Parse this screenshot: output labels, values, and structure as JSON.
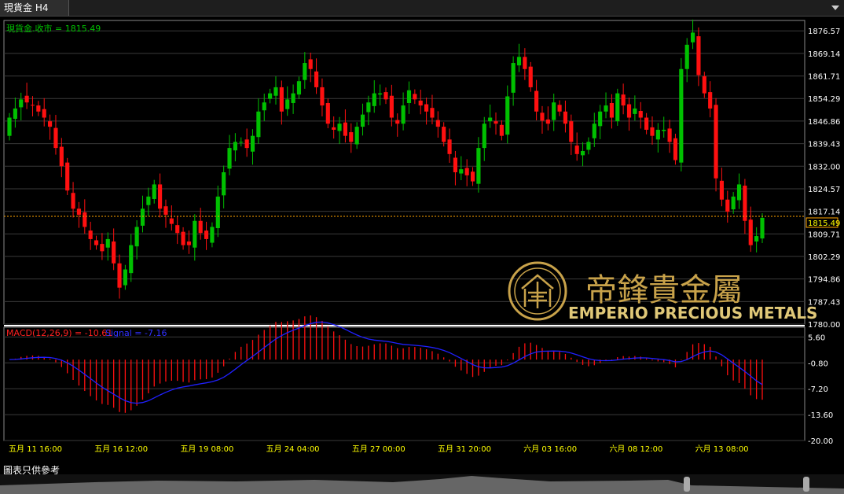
{
  "window": {
    "tab_title": "現貨金 H4"
  },
  "main_panel": {
    "label": "現貨金.收市 = 1815.49",
    "label_color": "#00c000",
    "current_price": "1815.49"
  },
  "macd_panel": {
    "label_name": "MACD(12,26,9) = -10.61",
    "label_signal": "Signal = -7.16",
    "name_color": "#ff2020",
    "signal_color": "#3030ff"
  },
  "watermark": {
    "chinese": "帝鋒貴金屬",
    "english": "EMPERIO PRECIOUS METALS",
    "color": "#c8a24a"
  },
  "footer": {
    "disclaimer": "圖表只供參考"
  },
  "colors": {
    "up": "#00c000",
    "down": "#ff1010",
    "grid": "#3a3a3a",
    "axis_text": "#ffffff",
    "date_text": "#ffff00",
    "price_line": "#ffa500"
  },
  "chart_data": [
    {
      "type": "candlestick",
      "title": "現貨金 H4",
      "ylim": [
        1780.0,
        1880.0
      ],
      "y_ticks": [
        "1876.57",
        "1869.14",
        "1861.71",
        "1854.29",
        "1846.86",
        "1839.43",
        "1832.00",
        "1824.57",
        "1817.14",
        "1809.71",
        "1802.29",
        "1794.86",
        "1787.43",
        "1780.00"
      ],
      "x_tick_labels": [
        "五月 11 16:00",
        "五月 16 12:00",
        "五月 19 08:00",
        "五月 24 04:00",
        "五月 27 00:00",
        "五月 31 20:00",
        "六月 03 16:00",
        "六月 08 12:00",
        "六月 13 08:00"
      ],
      "last_price": 1815.49,
      "close": [
        1848,
        1851,
        1854,
        1853,
        1852,
        1850,
        1848,
        1845,
        1838,
        1832,
        1824,
        1818,
        1816,
        1812,
        1808,
        1806,
        1804,
        1808,
        1800,
        1792,
        1798,
        1806,
        1812,
        1818,
        1822,
        1826,
        1818,
        1816,
        1813,
        1810,
        1806,
        1806,
        1814,
        1810,
        1808,
        1812,
        1822,
        1830,
        1838,
        1840,
        1840,
        1838,
        1842,
        1850,
        1853,
        1856,
        1858,
        1850,
        1854,
        1856,
        1860,
        1866,
        1864,
        1858,
        1852,
        1846,
        1844,
        1846,
        1842,
        1840,
        1845,
        1849,
        1853,
        1856,
        1856,
        1854,
        1848,
        1846,
        1852,
        1857,
        1854,
        1852,
        1850,
        1848,
        1845,
        1840,
        1836,
        1830,
        1831,
        1829,
        1827,
        1838,
        1846,
        1848,
        1846,
        1842,
        1855,
        1866,
        1868,
        1864,
        1858,
        1850,
        1847,
        1846,
        1853,
        1850,
        1846,
        1840,
        1836,
        1837,
        1840,
        1846,
        1850,
        1852,
        1848,
        1856,
        1852,
        1848,
        1851,
        1848,
        1844,
        1842,
        1844,
        1844,
        1840,
        1834,
        1864,
        1872,
        1876,
        1862,
        1856,
        1851,
        1828,
        1821,
        1817,
        1822,
        1826,
        1814,
        1806,
        1809,
        1815
      ],
      "ohlc_sample": {
        "first": [
          1840,
          1852,
          1836,
          1848
        ],
        "peak": [
          1872,
          1878,
          1868,
          1876
        ],
        "low": [
          1798,
          1802,
          1786,
          1792
        ]
      }
    },
    {
      "type": "macd",
      "title": "MACD(12,26,9)",
      "ylim": [
        -20.0,
        8.0
      ],
      "y_ticks": [
        "5.60",
        "-0.80",
        "-7.20",
        "-13.60",
        "-20.00"
      ],
      "macd_last": -10.61,
      "signal_last": -7.16
    }
  ]
}
